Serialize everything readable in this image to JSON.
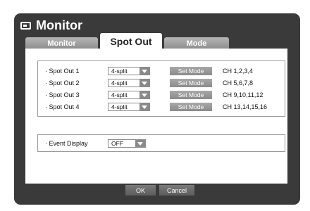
{
  "window": {
    "title": "Monitor",
    "icon": "monitor-icon"
  },
  "tabs": [
    {
      "label": "Monitor",
      "active": false
    },
    {
      "label": "Spot Out",
      "active": true
    },
    {
      "label": "Mode",
      "active": false
    }
  ],
  "spot_out": {
    "rows": [
      {
        "label": "· Spot Out 1",
        "split": "4-split",
        "button": "Set Mode",
        "channels": "CH 1,2,3,4"
      },
      {
        "label": "· Spot Out 2",
        "split": "4-split",
        "button": "Set Mode",
        "channels": "CH 5,6,7,8"
      },
      {
        "label": "· Spot Out 3",
        "split": "4-split",
        "button": "Set Mode",
        "channels": "CH 9,10,11,12"
      },
      {
        "label": "· Spot Out 4",
        "split": "4-split",
        "button": "Set Mode",
        "channels": "CH 13,14,15,16"
      }
    ]
  },
  "event_display": {
    "label": "· Event Display",
    "value": "OFF"
  },
  "footer": {
    "ok_label": "OK",
    "cancel_label": "Cancel"
  },
  "colors": {
    "window_bg": "#3a3a3a",
    "content_bg": "#ffffff",
    "tab_inactive": "#9e9e9e",
    "button_gray": "#999999"
  }
}
